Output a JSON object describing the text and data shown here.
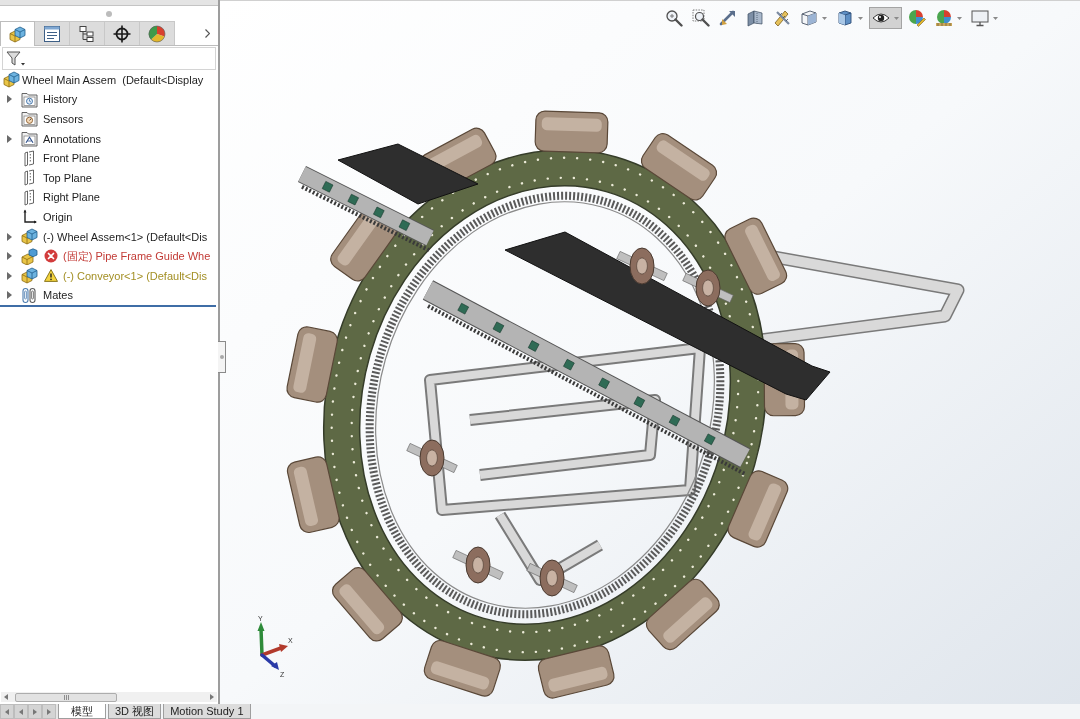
{
  "feature_manager": {
    "panel_tabs": [
      {
        "kind": "feature-tree",
        "selected": true
      },
      {
        "kind": "property",
        "selected": false
      },
      {
        "kind": "configuration",
        "selected": false
      },
      {
        "kind": "dimxpert",
        "selected": false
      },
      {
        "kind": "display",
        "selected": false
      }
    ],
    "tree": {
      "label": "Wheel Main Assem  (Default<Display",
      "kind": "assembly",
      "children": [
        {
          "label": "History",
          "kind": "history",
          "expandable": true
        },
        {
          "label": "Sensors",
          "kind": "sensors",
          "expandable": false
        },
        {
          "label": "Annotations",
          "kind": "annotations",
          "expandable": true
        },
        {
          "label": "Front Plane",
          "kind": "plane",
          "expandable": false
        },
        {
          "label": "Top Plane",
          "kind": "plane",
          "expandable": false
        },
        {
          "label": "Right Plane",
          "kind": "plane",
          "expandable": false
        },
        {
          "label": "Origin",
          "kind": "origin",
          "expandable": false
        },
        {
          "label": "(-) Wheel Assem<1> (Default<Dis",
          "kind": "assembly",
          "expandable": true
        },
        {
          "label": "(固定) Pipe Frame Guide Whe",
          "kind": "part",
          "expandable": true,
          "badge": {
            "kind": "error"
          }
        },
        {
          "label": "(-) Conveyor<1> (Default<Dis",
          "kind": "assembly",
          "expandable": true,
          "badge": {
            "kind": "warning"
          }
        },
        {
          "label": "Mates",
          "kind": "mates",
          "expandable": true
        }
      ]
    }
  },
  "view_toolbar": [
    {
      "kind": "zoom-fit",
      "dropdown": false,
      "pressed": false
    },
    {
      "kind": "zoom-area",
      "dropdown": false,
      "pressed": false
    },
    {
      "kind": "previous-view",
      "dropdown": false,
      "pressed": false
    },
    {
      "kind": "section-view",
      "dropdown": false,
      "pressed": false
    },
    {
      "kind": "dynamic-annotation",
      "dropdown": false,
      "pressed": false
    },
    {
      "kind": "view-orientation",
      "dropdown": true,
      "pressed": false
    },
    {
      "kind": "display-style",
      "dropdown": true,
      "pressed": false
    },
    {
      "kind": "hide-show",
      "dropdown": true,
      "pressed": true
    },
    {
      "kind": "edit-appearance",
      "dropdown": false,
      "pressed": false
    },
    {
      "kind": "apply-scene",
      "dropdown": true,
      "pressed": false
    },
    {
      "kind": "view-settings",
      "dropdown": true,
      "pressed": false
    }
  ],
  "triad": [
    {
      "kind": "y",
      "label": "Y",
      "color": "#2e8b3a"
    },
    {
      "kind": "x",
      "label": "X",
      "color": "#b23a2c"
    },
    {
      "kind": "z",
      "label": "Z",
      "color": "#2a3aa8"
    }
  ],
  "bottom_tabs": [
    {
      "label": "模型",
      "selected": true
    },
    {
      "label": "3D 视图",
      "selected": false
    },
    {
      "label": "Motion Study 1",
      "selected": false
    }
  ]
}
